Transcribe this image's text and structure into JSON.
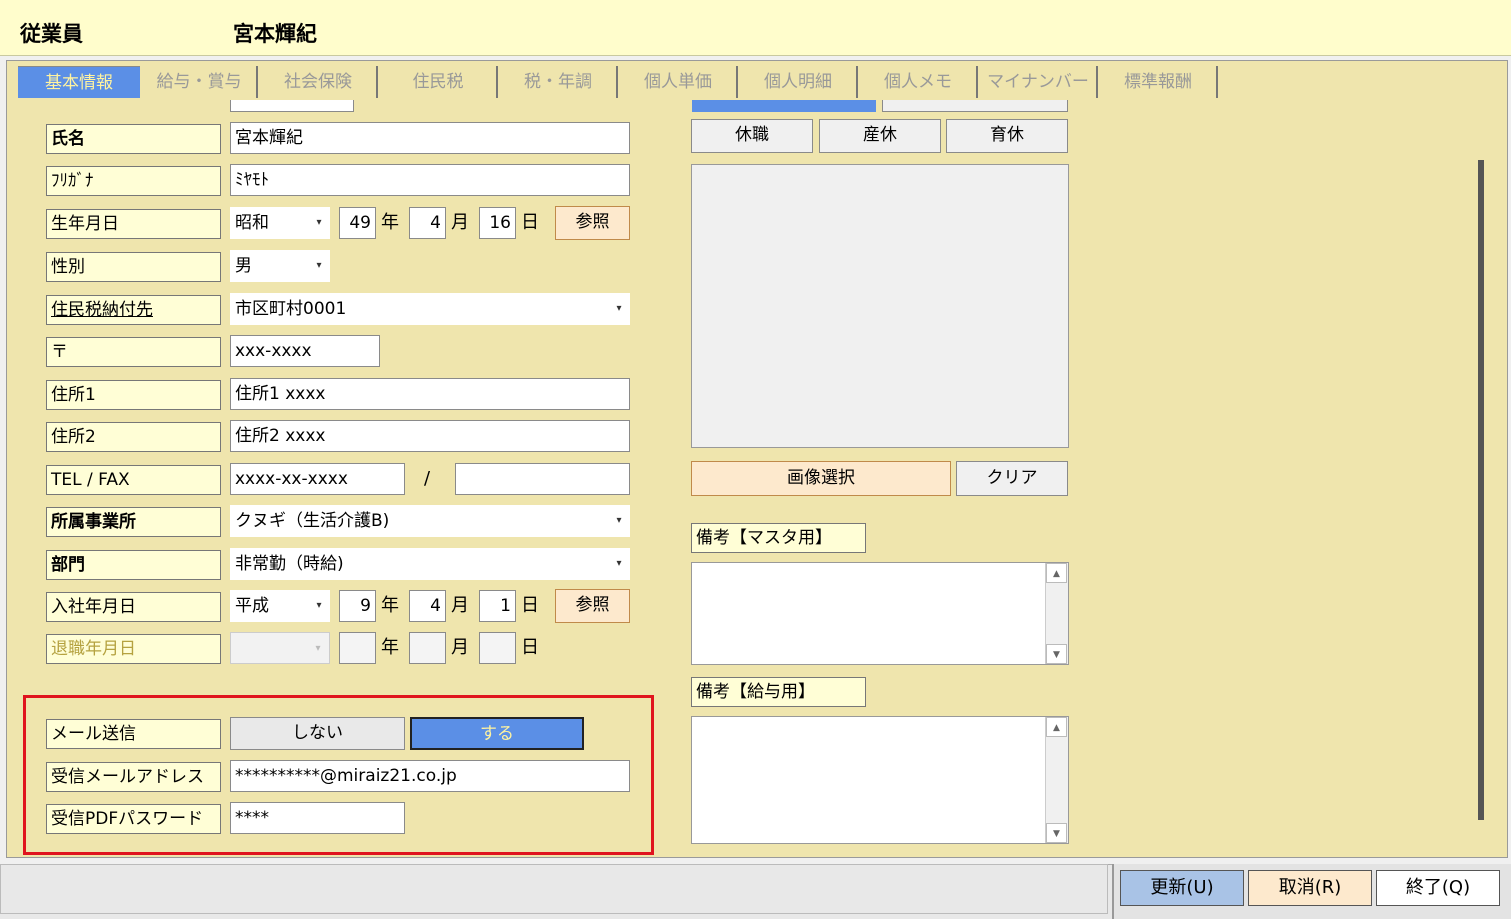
{
  "header": {
    "form_title": "従業員",
    "employee_name": "宮本輝紀"
  },
  "tabs": [
    "基本情報",
    "給与・賞与",
    "社会保険",
    "住民税",
    "税・年調",
    "個人単価",
    "個人明細",
    "個人メモ",
    "マイナンバー",
    "標準報酬"
  ],
  "fields": {
    "name": {
      "label": "氏名",
      "value": "宮本輝紀"
    },
    "kana": {
      "label": "ﾌﾘｶﾞﾅ",
      "value": "ﾐﾔﾓﾄ"
    },
    "birth": {
      "label": "生年月日",
      "era": "昭和",
      "year": "49",
      "month": "4",
      "day": "16",
      "ref": "参照"
    },
    "gender": {
      "label": "性別",
      "value": "男"
    },
    "tax_dest": {
      "label": "住民税納付先",
      "value": "市区町村0001"
    },
    "zip": {
      "label": "〒",
      "value": "xxx-xxxx"
    },
    "addr1": {
      "label": "住所1",
      "value": "住所1 xxxx"
    },
    "addr2": {
      "label": "住所2",
      "value": "住所2 xxxx"
    },
    "tel": {
      "label": "TEL / FAX",
      "tel": "xxxx-xx-xxxx",
      "sep": "/",
      "fax": ""
    },
    "office": {
      "label": "所属事業所",
      "value": "クヌギ（生活介護B)"
    },
    "dept": {
      "label": "部門",
      "value": "非常勤（時給)"
    },
    "join": {
      "label": "入社年月日",
      "era": "平成",
      "year": "9",
      "month": "4",
      "day": "1",
      "ref": "参照"
    },
    "retire": {
      "label": "退職年月日",
      "era": "",
      "year": "",
      "month": "",
      "day": ""
    },
    "mail_send": {
      "label": "メール送信",
      "no": "しない",
      "yes": "する",
      "selected": "する"
    },
    "mail_addr": {
      "label": "受信メールアドレス",
      "value": "**********@miraiz21.co.jp"
    },
    "pdf_pw": {
      "label": "受信PDFパスワード",
      "value": "****"
    }
  },
  "units": {
    "year": "年",
    "month": "月",
    "day": "日"
  },
  "right": {
    "status_buttons": [
      "休職",
      "産休",
      "育休"
    ],
    "image_select": "画像選択",
    "clear": "クリア",
    "memo_master_label": "備考【マスタ用】",
    "memo_salary_label": "備考【給与用】"
  },
  "footer": {
    "update": "更新(U)",
    "cancel": "取消(R)",
    "exit": "終了(Q)"
  },
  "colors": {
    "accent_blue": "#5b8fe6",
    "panel": "#efe5ad",
    "label_bg": "#fffed6",
    "highlight": "#e0141e"
  }
}
